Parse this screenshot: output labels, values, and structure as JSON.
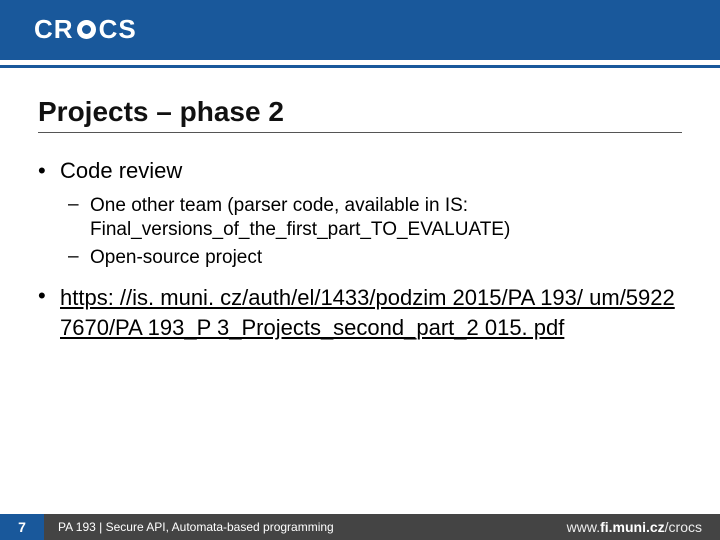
{
  "header": {
    "logo_text_left": "CR",
    "logo_text_right": "CS"
  },
  "title": "Projects – phase 2",
  "bullets": {
    "code_review_label": "Code review",
    "sub1": "One other team (parser code, available in IS: Final_versions_of_the_first_part_TO_EVALUATE)",
    "sub2": "Open-source project",
    "link_text": "https: //is. muni. cz/auth/el/1433/podzim 2015/PA 193/ um/59227670/PA 193_P 3_Projects_second_part_2 015. pdf"
  },
  "footer": {
    "page_number": "7",
    "course_line": "PA 193 | Secure API, Automata-based programming",
    "site_www": "www.",
    "site_host": "fi.muni.cz",
    "site_path": "/crocs"
  }
}
